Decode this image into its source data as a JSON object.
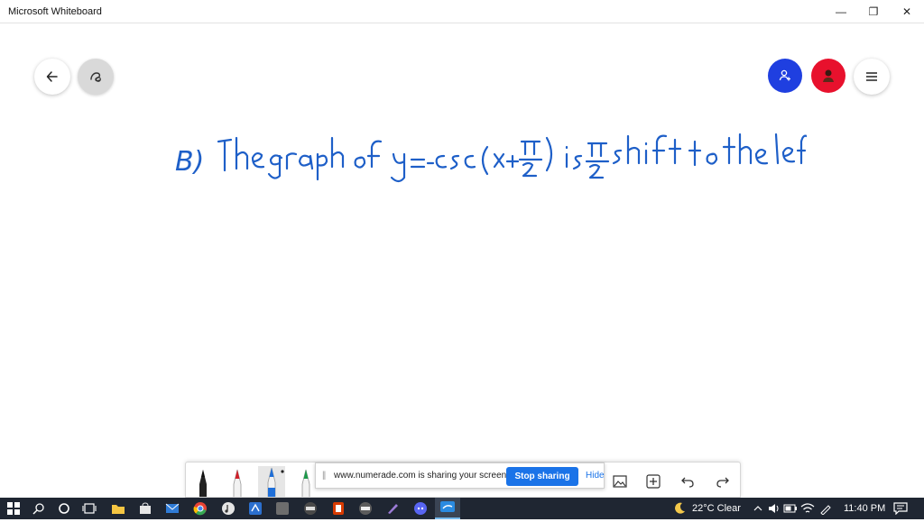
{
  "window": {
    "title": "Microsoft Whiteboard",
    "minimize": "—",
    "maximize": "❐",
    "close": "✕"
  },
  "canvas": {
    "buttons": {
      "back": "back-arrow-icon",
      "ink": "ink-beautify-icon",
      "invite": "add-person-icon",
      "avatar": "user-avatar",
      "menu": "hamburger-menu-icon"
    },
    "handwriting": {
      "label": "B)",
      "text": "The graph of y=-csc(x+π/2) is π/2 shift to the left"
    }
  },
  "toolbar": {
    "pens": [
      {
        "name": "black-pen",
        "color": "#111111"
      },
      {
        "name": "red-pen",
        "color": "#d0202a"
      },
      {
        "name": "blue-pen",
        "color": "#1e6fd9",
        "selected": true
      },
      {
        "name": "green-pen",
        "color": "#1c9a4a"
      }
    ],
    "icons": [
      "image-icon",
      "add-icon",
      "undo-icon",
      "redo-icon"
    ]
  },
  "sharing": {
    "message": "www.numerade.com is sharing your screen.",
    "stop_label": "Stop sharing",
    "hide_label": "Hide"
  },
  "taskbar": {
    "weather": "22°C  Clear",
    "time": "11:40 PM"
  }
}
